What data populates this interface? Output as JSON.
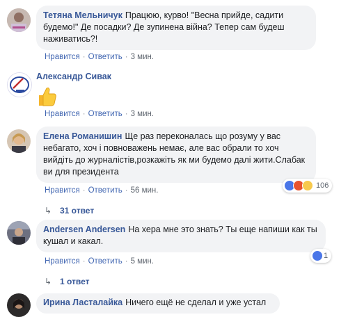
{
  "comments": [
    {
      "author": "Тетяна Мельничук",
      "text": "Працюю, курво! \"Весна прийде, садити будемо!\" Де посадки? Де зупинена війна? Тепер сам будеш наживатись?!",
      "like": "Нравится",
      "reply": "Ответить",
      "time": "3 мин."
    },
    {
      "author": "Александр Сивак",
      "text": "",
      "like": "Нравится",
      "reply": "Ответить",
      "time": "3 мин."
    },
    {
      "author": "Елена Романишин",
      "text": "Ще раз переконалась що розуму у вас небагато, хоч і повноважень немає, але вас обрали то хоч вийдіть до журналістів,розкажіть як ми будемо далі жити.Слабак ви для президента",
      "like": "Нравится",
      "reply": "Ответить",
      "time": "56 мин.",
      "reactions_count": "106",
      "replies_label": "31 ответ"
    },
    {
      "author": "Andersen Andersen",
      "text": "На хера мне это знать? Ты еще напиши как ты кушал и какал.",
      "like": "Нравится",
      "reply": "Ответить",
      "time": "5 мин.",
      "reactions_count": "1",
      "replies_label": "1 ответ"
    },
    {
      "author": "Ирина Ласталайка",
      "text": "Ничего ещё не сделал и уже устал"
    }
  ],
  "icons": {
    "reply_arrow": "reply-arrow-icon",
    "thumbs_up": "thumbs-up-emoji-icon"
  },
  "colors": {
    "author": "#385898",
    "bubble": "#f2f3f5",
    "like_reaction": "#4a76e8",
    "angry_reaction": "#e8532f",
    "haha_reaction": "#f7c94d"
  }
}
